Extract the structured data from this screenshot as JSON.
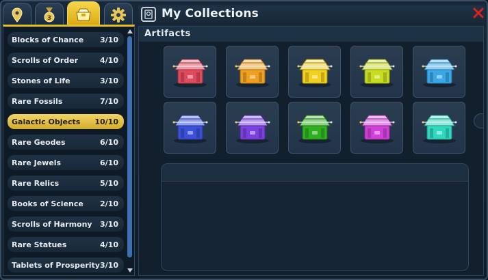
{
  "tabs": [
    {
      "icon": "location-pin-icon",
      "active": false
    },
    {
      "icon": "medal-icon",
      "active": false
    },
    {
      "icon": "collections-icon",
      "active": true
    },
    {
      "icon": "gear-icon",
      "active": false
    }
  ],
  "header": {
    "title": "My Collections",
    "icon": "collections-icon",
    "close_icon": "close-icon"
  },
  "collections": [
    {
      "label": "Blocks of Chance",
      "count": "3/10",
      "selected": false
    },
    {
      "label": "Scrolls of Order",
      "count": "4/10",
      "selected": false
    },
    {
      "label": "Stones of Life",
      "count": "3/10",
      "selected": false
    },
    {
      "label": "Rare Fossils",
      "count": "7/10",
      "selected": false
    },
    {
      "label": "Galactic Objects",
      "count": "10/10",
      "selected": true
    },
    {
      "label": "Rare Geodes",
      "count": "6/10",
      "selected": false
    },
    {
      "label": "Rare Jewels",
      "count": "6/10",
      "selected": false
    },
    {
      "label": "Rare Relics",
      "count": "5/10",
      "selected": false
    },
    {
      "label": "Books of Science",
      "count": "2/10",
      "selected": false
    },
    {
      "label": "Scrolls of Harmony",
      "count": "3/10",
      "selected": false
    },
    {
      "label": "Rare Statues",
      "count": "4/10",
      "selected": false
    },
    {
      "label": "Tablets of Prosperity",
      "count": "3/10",
      "selected": false
    }
  ],
  "artifacts": {
    "section_title": "Artifacts",
    "items": [
      {
        "color": "#e04a5e"
      },
      {
        "color": "#f0a020"
      },
      {
        "color": "#f2d020"
      },
      {
        "color": "#c8dc20"
      },
      {
        "color": "#3aa8e8"
      },
      {
        "color": "#3a50d8"
      },
      {
        "color": "#7a40e0"
      },
      {
        "color": "#30b020"
      },
      {
        "color": "#d040d8"
      },
      {
        "color": "#30d8c0"
      }
    ]
  },
  "colors": {
    "accent": "#e6bf2f",
    "close": "#e02020",
    "scroll_thumb": "#3d6fb3"
  }
}
